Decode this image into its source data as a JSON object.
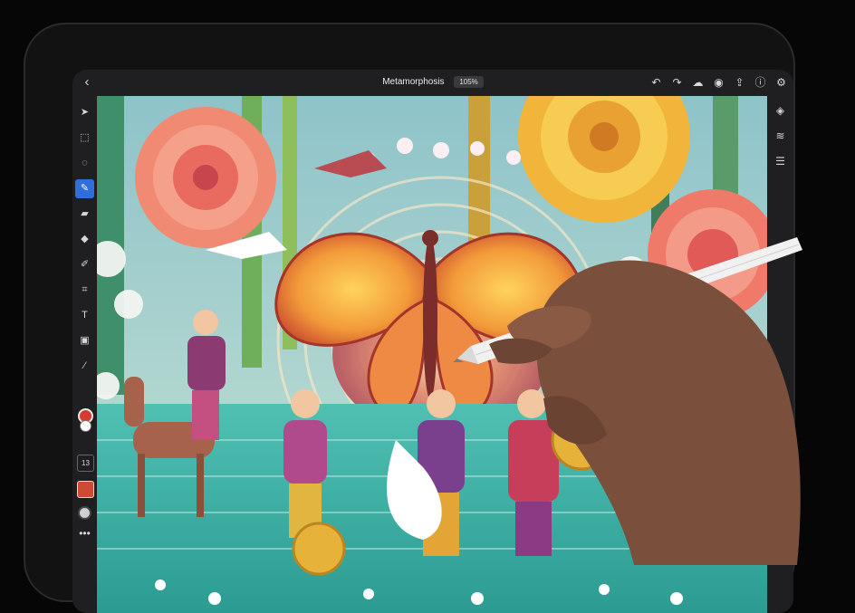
{
  "app": {
    "document_title": "Metamorphosis",
    "zoom_level": "105%"
  },
  "top_bar": {
    "back_icon": "chevron-left-icon",
    "right_icons": [
      "undo-icon",
      "redo-icon",
      "cloud-icon",
      "user-icon",
      "share-icon",
      "help-icon",
      "gear-icon"
    ]
  },
  "left_toolbar": {
    "tools": [
      "select-arrow-icon",
      "transform-icon",
      "lasso-icon",
      "brush-icon",
      "eraser-icon",
      "fill-bucket-icon",
      "smudge-icon",
      "crop-icon",
      "text-icon",
      "image-icon",
      "eyedropper-icon"
    ],
    "active_tool": "brush-icon",
    "brush_size": "13",
    "colors": {
      "foreground": "#d63b2f",
      "background": "#ffffff",
      "current_swatch": "#cf4a35"
    }
  },
  "right_toolbar": {
    "tools": [
      "layers-icon",
      "layer-properties-icon",
      "adjustments-icon"
    ]
  },
  "colors": {
    "ui_background": "#1f1f21",
    "accent": "#2f6fdb"
  }
}
